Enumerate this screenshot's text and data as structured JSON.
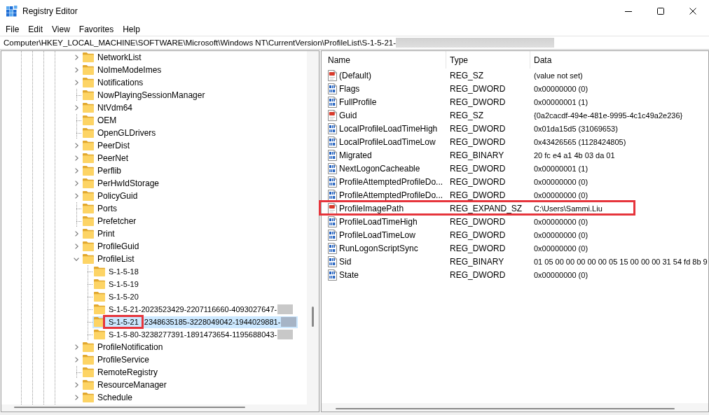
{
  "window": {
    "title": "Registry Editor"
  },
  "menu": [
    "File",
    "Edit",
    "View",
    "Favorites",
    "Help"
  ],
  "address_bar": {
    "value": "Computer\\HKEY_LOCAL_MACHINE\\SOFTWARE\\Microsoft\\Windows NT\\CurrentVersion\\ProfileList\\S-1-5-21-",
    "redacted": true
  },
  "tree": {
    "items": [
      {
        "label": "NetworkList",
        "expandable": true,
        "expanded": false,
        "selected": false
      },
      {
        "label": "NoImeModeImes",
        "expandable": true,
        "expanded": false,
        "selected": false
      },
      {
        "label": "Notifications",
        "expandable": true,
        "expanded": false,
        "selected": false
      },
      {
        "label": "NowPlayingSessionManager",
        "expandable": false,
        "selected": false
      },
      {
        "label": "NtVdm64",
        "expandable": true,
        "expanded": false,
        "selected": false
      },
      {
        "label": "OEM",
        "expandable": false,
        "selected": false
      },
      {
        "label": "OpenGLDrivers",
        "expandable": false,
        "selected": false
      },
      {
        "label": "PeerDist",
        "expandable": true,
        "expanded": false,
        "selected": false
      },
      {
        "label": "PeerNet",
        "expandable": true,
        "expanded": false,
        "selected": false
      },
      {
        "label": "Perflib",
        "expandable": true,
        "expanded": false,
        "selected": false
      },
      {
        "label": "PerHwIdStorage",
        "expandable": true,
        "expanded": false,
        "selected": false
      },
      {
        "label": "PolicyGuid",
        "expandable": true,
        "expanded": false,
        "selected": false
      },
      {
        "label": "Ports",
        "expandable": false,
        "selected": false
      },
      {
        "label": "Prefetcher",
        "expandable": false,
        "selected": false
      },
      {
        "label": "Print",
        "expandable": true,
        "expanded": false,
        "selected": false
      },
      {
        "label": "ProfileGuid",
        "expandable": true,
        "expanded": false,
        "selected": false
      },
      {
        "label": "ProfileList",
        "expandable": true,
        "expanded": true,
        "selected": false,
        "children": [
          {
            "label": "S-1-5-18",
            "expandable": false,
            "selected": false,
            "redacted": false,
            "framed": false
          },
          {
            "label": "S-1-5-19",
            "expandable": false,
            "selected": false,
            "redacted": false,
            "framed": false
          },
          {
            "label": "S-1-5-20",
            "expandable": false,
            "selected": false,
            "redacted": false,
            "framed": false
          },
          {
            "label": "S-1-5-21-2023523429-2207116660-4093027647-",
            "expandable": false,
            "selected": false,
            "redacted": true,
            "framed": false
          },
          {
            "label": "S-1-5-21",
            "label_continued": "2348635185-3228049042-1944029881-",
            "expandable": false,
            "selected": true,
            "redacted": true,
            "framed": true
          },
          {
            "label": "S-1-5-80-3238277391-1891473654-1195688043-",
            "expandable": false,
            "selected": false,
            "redacted": true,
            "framed": false
          }
        ]
      },
      {
        "label": "ProfileNotification",
        "expandable": true,
        "expanded": false,
        "selected": false
      },
      {
        "label": "ProfileService",
        "expandable": true,
        "expanded": false,
        "selected": false
      },
      {
        "label": "RemoteRegistry",
        "expandable": false,
        "selected": false
      },
      {
        "label": "ResourceManager",
        "expandable": true,
        "expanded": false,
        "selected": false
      },
      {
        "label": "Schedule",
        "expandable": true,
        "expanded": false,
        "selected": false
      }
    ]
  },
  "values": {
    "columns": [
      "Name",
      "Type",
      "Data"
    ],
    "rows": [
      {
        "kind": "string",
        "name": "(Default)",
        "type": "REG_SZ",
        "data": "(value not set)",
        "framed": false
      },
      {
        "kind": "binary",
        "name": "Flags",
        "type": "REG_DWORD",
        "data": "0x00000000 (0)",
        "framed": false
      },
      {
        "kind": "binary",
        "name": "FullProfile",
        "type": "REG_DWORD",
        "data": "0x00000001 (1)",
        "framed": false
      },
      {
        "kind": "string",
        "name": "Guid",
        "type": "REG_SZ",
        "data": "{0a2cacdf-494e-481e-9995-4c1c49a2e236}",
        "framed": false
      },
      {
        "kind": "binary",
        "name": "LocalProfileLoadTimeHigh",
        "type": "REG_DWORD",
        "data": "0x01da15d5 (31069653)",
        "framed": false
      },
      {
        "kind": "binary",
        "name": "LocalProfileLoadTimeLow",
        "type": "REG_DWORD",
        "data": "0x43426565 (1128424805)",
        "framed": false
      },
      {
        "kind": "binary",
        "name": "Migrated",
        "type": "REG_BINARY",
        "data": "20 fc e4 a1 4b 03 da 01",
        "framed": false
      },
      {
        "kind": "binary",
        "name": "NextLogonCacheable",
        "type": "REG_DWORD",
        "data": "0x00000001 (1)",
        "framed": false
      },
      {
        "kind": "binary",
        "name": "ProfileAttemptedProfileDo...",
        "type": "REG_DWORD",
        "data": "0x00000000 (0)",
        "framed": false
      },
      {
        "kind": "binary",
        "name": "ProfileAttemptedProfileDo...",
        "type": "REG_DWORD",
        "data": "0x00000000 (0)",
        "framed": false
      },
      {
        "kind": "string",
        "name": "ProfileImagePath",
        "type": "REG_EXPAND_SZ",
        "data": "C:\\Users\\Sammi.Liu",
        "framed": true
      },
      {
        "kind": "binary",
        "name": "ProfileLoadTimeHigh",
        "type": "REG_DWORD",
        "data": "0x00000000 (0)",
        "framed": false
      },
      {
        "kind": "binary",
        "name": "ProfileLoadTimeLow",
        "type": "REG_DWORD",
        "data": "0x00000000 (0)",
        "framed": false
      },
      {
        "kind": "binary",
        "name": "RunLogonScriptSync",
        "type": "REG_DWORD",
        "data": "0x00000000 (0)",
        "framed": false
      },
      {
        "kind": "binary",
        "name": "Sid",
        "type": "REG_BINARY",
        "data": "01 05 00 00 00 00 00 05 15 00 00 00 31 54 fd 8b 9",
        "framed": false
      },
      {
        "kind": "binary",
        "name": "State",
        "type": "REG_DWORD",
        "data": "0x00000000 (0)",
        "framed": false
      }
    ]
  }
}
